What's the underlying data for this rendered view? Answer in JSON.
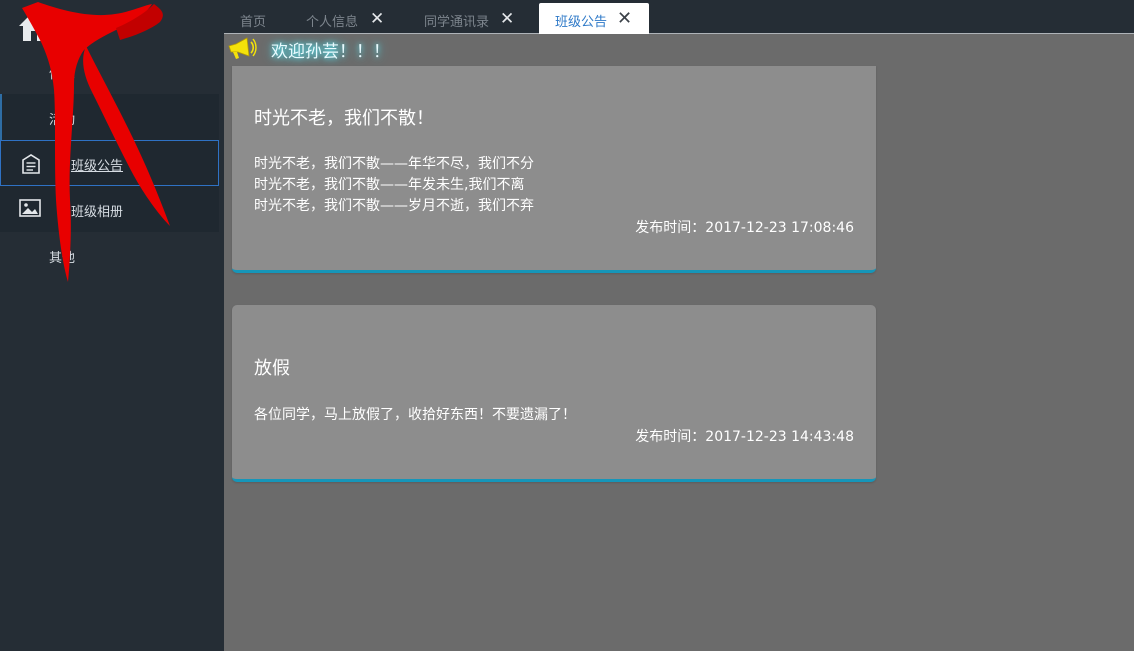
{
  "sidebar": {
    "items": [
      {
        "label": "首页",
        "icon": "home-icon"
      },
      {
        "label": "信息"
      },
      {
        "label": "活动"
      },
      {
        "label": "班级公告",
        "icon": "notice-icon"
      },
      {
        "label": "班级相册",
        "icon": "image-icon"
      },
      {
        "label": "其他"
      }
    ],
    "decoration": "red-scarf-icon"
  },
  "tabs": [
    {
      "label": "首页",
      "active": false
    },
    {
      "label": "个人信息",
      "closable": true,
      "active": false
    },
    {
      "label": "同学通讯录",
      "closable": true,
      "active": false
    },
    {
      "label": "班级公告",
      "closable": true,
      "active": true
    }
  ],
  "welcome": {
    "text": "欢迎孙芸！！！",
    "icon": "megaphone-icon"
  },
  "notices": [
    {
      "title": "时光不老，我们不散！",
      "lines": [
        "时光不老，我们不散——年华不尽，我们不分",
        "时光不老，我们不散——年发未生,我们不离",
        "时光不老，我们不散——岁月不逝，我们不弃"
      ],
      "time": "发布时间：2017-12-23 17:08:46"
    },
    {
      "title": "放假",
      "lines": [
        "各位同学，马上放假了，收拾好东西！不要遗漏了！"
      ],
      "time": "发布时间：2017-12-23 14:43:48"
    }
  ],
  "colors": {
    "sidebar_bg": "#252d35",
    "content_bg": "#6b6b6b",
    "card_bg": "#8d8d8d",
    "card_accent": "#1696b9",
    "active_tab_text": "#2e79c8",
    "welcome_glow": "#5ff2ff"
  }
}
